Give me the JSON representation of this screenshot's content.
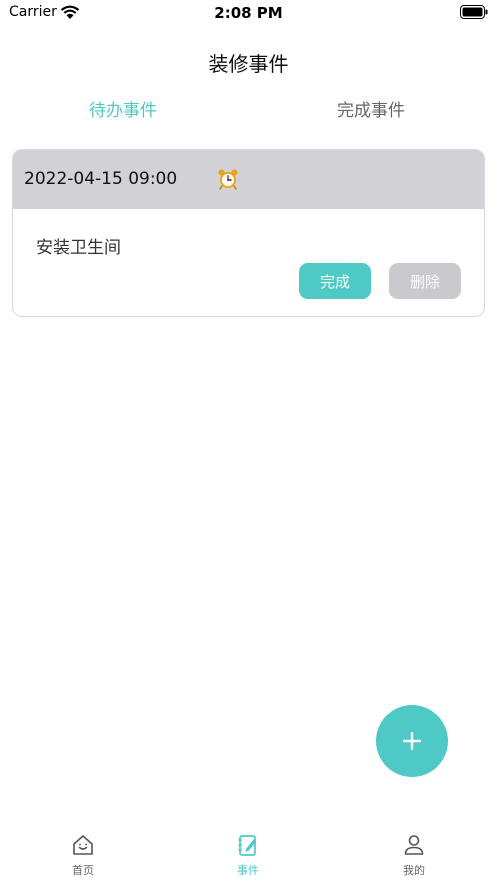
{
  "status_bar": {
    "carrier": "Carrier",
    "time": "2:08 PM"
  },
  "header": {
    "title": "装修事件"
  },
  "tabs": {
    "pending_label": "待办事件",
    "done_label": "完成事件",
    "active": "pending"
  },
  "events": [
    {
      "datetime": "2022-04-15 09:00",
      "icon": "alarm-clock-icon",
      "content": "安装卫生间",
      "complete_label": "完成",
      "delete_label": "删除"
    }
  ],
  "fab": {
    "icon": "plus-icon"
  },
  "tabbar": {
    "items": [
      {
        "label": "首页",
        "icon": "home-icon"
      },
      {
        "label": "事件",
        "icon": "notebook-icon"
      },
      {
        "label": "我的",
        "icon": "user-icon"
      }
    ],
    "active_index": 1
  },
  "colors": {
    "accent": "#4ec9c5",
    "card_header": "#d1d1d6",
    "delete_button": "#c9c9ce"
  }
}
